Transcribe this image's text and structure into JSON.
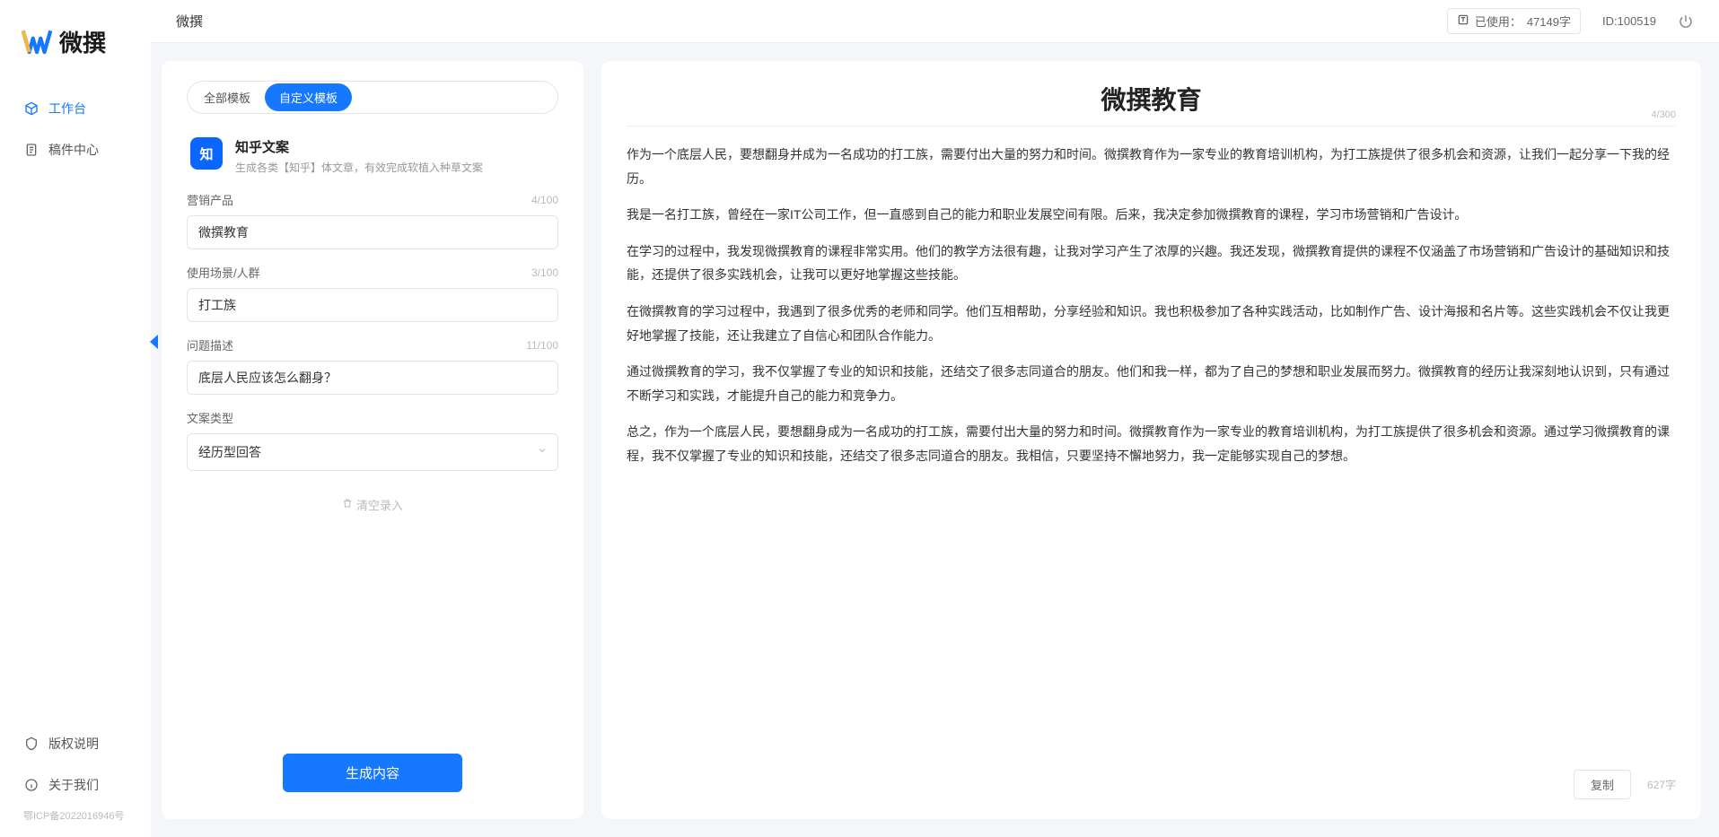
{
  "brand": {
    "name": "微撰"
  },
  "sidebar": {
    "nav": [
      {
        "label": "工作台",
        "icon": "cube"
      },
      {
        "label": "稿件中心",
        "icon": "doc"
      }
    ],
    "bottom": [
      {
        "label": "版权说明",
        "icon": "shield"
      },
      {
        "label": "关于我们",
        "icon": "info"
      }
    ],
    "icp": "鄂ICP备2022016946号"
  },
  "topbar": {
    "title": "微撰",
    "usage_label": "已使用：",
    "usage_value": "47149字",
    "id_label": "ID:100519"
  },
  "left": {
    "tabs": [
      {
        "label": "全部模板",
        "active": false
      },
      {
        "label": "自定义模板",
        "active": true
      }
    ],
    "template": {
      "icon_text": "知",
      "title": "知乎文案",
      "desc": "生成各类【知乎】体文章，有效完成软植入种草文案"
    },
    "fields": {
      "product": {
        "label": "营销产品",
        "value": "微撰教育",
        "count": "4/100"
      },
      "scene": {
        "label": "使用场景/人群",
        "value": "打工族",
        "count": "3/100"
      },
      "question": {
        "label": "问题描述",
        "value": "底层人民应该怎么翻身？",
        "count": "11/100"
      },
      "type": {
        "label": "文案类型",
        "value": "经历型回答"
      }
    },
    "clear_label": "清空录入",
    "generate_label": "生成内容"
  },
  "right": {
    "title": "微撰教育",
    "title_counter": "4/300",
    "paragraphs": [
      "作为一个底层人民，要想翻身并成为一名成功的打工族，需要付出大量的努力和时间。微撰教育作为一家专业的教育培训机构，为打工族提供了很多机会和资源，让我们一起分享一下我的经历。",
      "我是一名打工族，曾经在一家IT公司工作，但一直感到自己的能力和职业发展空间有限。后来，我决定参加微撰教育的课程，学习市场营销和广告设计。",
      "在学习的过程中，我发现微撰教育的课程非常实用。他们的教学方法很有趣，让我对学习产生了浓厚的兴趣。我还发现，微撰教育提供的课程不仅涵盖了市场营销和广告设计的基础知识和技能，还提供了很多实践机会，让我可以更好地掌握这些技能。",
      "在微撰教育的学习过程中，我遇到了很多优秀的老师和同学。他们互相帮助，分享经验和知识。我也积极参加了各种实践活动，比如制作广告、设计海报和名片等。这些实践机会不仅让我更好地掌握了技能，还让我建立了自信心和团队合作能力。",
      "通过微撰教育的学习，我不仅掌握了专业的知识和技能，还结交了很多志同道合的朋友。他们和我一样，都为了自己的梦想和职业发展而努力。微撰教育的经历让我深刻地认识到，只有通过不断学习和实践，才能提升自己的能力和竞争力。",
      "总之，作为一个底层人民，要想翻身成为一名成功的打工族，需要付出大量的努力和时间。微撰教育作为一家专业的教育培训机构，为打工族提供了很多机会和资源。通过学习微撰教育的课程，我不仅掌握了专业的知识和技能，还结交了很多志同道合的朋友。我相信，只要坚持不懈地努力，我一定能够实现自己的梦想。"
    ],
    "copy_label": "复制",
    "char_count": "627字"
  }
}
